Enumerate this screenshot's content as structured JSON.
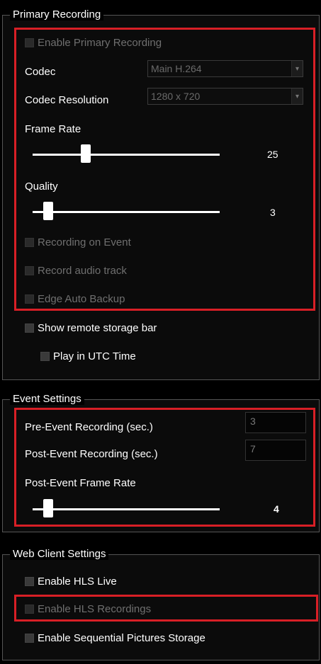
{
  "primary": {
    "legend": "Primary Recording",
    "enable_primary": "Enable Primary Recording",
    "codec_label": "Codec",
    "codec_value": "Main H.264",
    "res_label": "Codec Resolution",
    "res_value": "1280 x 720",
    "framerate_label": "Frame Rate",
    "framerate_value": "25",
    "framerate_level": 0.27,
    "quality_label": "Quality",
    "quality_value": "3",
    "quality_level": 0.06,
    "recording_on_event": "Recording on Event",
    "record_audio": "Record audio track",
    "edge_backup": "Edge Auto Backup",
    "show_remote": "Show remote storage bar",
    "play_utc": "Play in UTC Time"
  },
  "event": {
    "legend": "Event Settings",
    "pre_label": "Pre-Event Recording (sec.)",
    "pre_value": "3",
    "post_label": "Post-Event Recording (sec.)",
    "post_value": "7",
    "post_fr_label": "Post-Event Frame Rate",
    "post_fr_value": "4",
    "post_fr_level": 0.06
  },
  "web": {
    "legend": "Web Client Settings",
    "hls_live": "Enable HLS Live",
    "hls_recordings": "Enable HLS Recordings",
    "sequential": "Enable Sequential Pictures Storage"
  },
  "colors": {
    "highlight": "#d81f26"
  }
}
